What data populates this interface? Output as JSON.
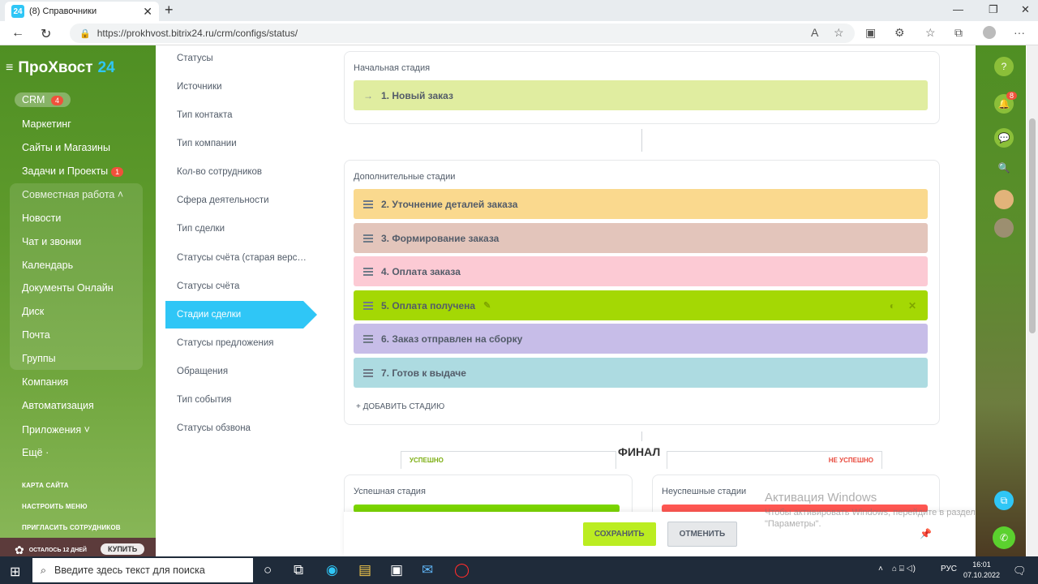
{
  "browser": {
    "tab_title": "(8) Справочники",
    "url": "https://prokhvost.bitrix24.ru/crm/configs/status/"
  },
  "leftnav": {
    "logo": "ПроХвост",
    "logo_num": "24",
    "crm": "CRM",
    "crm_badge": "4",
    "items": [
      "Маркетинг",
      "Сайты и Магазины",
      "Задачи и Проекты",
      "Совместная работа",
      "Новости",
      "Чат и звонки",
      "Календарь",
      "Документы Онлайн",
      "Диск",
      "Почта",
      "Группы",
      "Компания",
      "Автоматизация",
      "Приложения",
      "Ещё"
    ],
    "tasks_badge": "1",
    "small_links": [
      "КАРТА САЙТА",
      "НАСТРОИТЬ МЕНЮ",
      "ПРИГЛАСИТЬ СОТРУДНИКОВ"
    ],
    "promo_text": "ОСТАЛОСЬ 12 ДНЕЙ",
    "buy": "КУПИТЬ"
  },
  "config_list": [
    "Статусы",
    "Источники",
    "Тип контакта",
    "Тип компании",
    "Кол-во сотрудников",
    "Сфера деятельности",
    "Тип сделки",
    "Статусы счёта (старая верс…",
    "Статусы счёта",
    "Стадии сделки",
    "Статусы предложения",
    "Обращения",
    "Тип события",
    "Статусы обзвона"
  ],
  "panels": {
    "initial_title": "Начальная стадия",
    "initial_stage": "1. Новый заказ",
    "extra_title": "Дополнительные стадии",
    "stages": [
      {
        "label": "2. Уточнение деталей заказа",
        "color": "#fad98e"
      },
      {
        "label": "3. Формирование заказа",
        "color": "#e3c5bb"
      },
      {
        "label": "4. Оплата заказа",
        "color": "#fccad4"
      },
      {
        "label": "5. Оплата получена",
        "color": "#a4d804"
      },
      {
        "label": "6. Заказ отправлен на сборку",
        "color": "#c7bde8"
      },
      {
        "label": "7. Готов к выдаче",
        "color": "#addbe1"
      }
    ],
    "add_stage": "+ ДОБАВИТЬ СТАДИЮ",
    "final": "ФИНАЛ",
    "success_tab": "УСПЕШНО",
    "fail_tab": "НЕ УСПЕШНО",
    "success_title": "Успешная стадия",
    "fail_title": "Неуспешные стадии"
  },
  "footer": {
    "save": "СОХРАНИТЬ",
    "cancel": "ОТМЕНИТЬ"
  },
  "watermark": {
    "line1": "Активация Windows",
    "line2": "Чтобы активировать Windows, перейдите в раздел",
    "line3": "\"Параметры\"."
  },
  "taskbar": {
    "search": "Введите здесь текст для поиска",
    "lang": "РУС",
    "time": "16:01",
    "date": "07.10.2022"
  },
  "right_rail": {
    "notif_badge": "8"
  }
}
